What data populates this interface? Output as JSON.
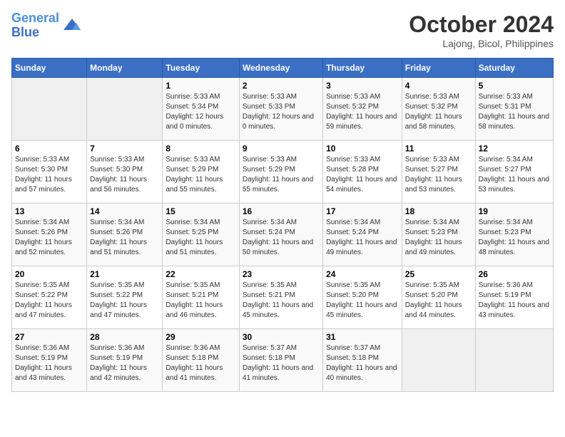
{
  "header": {
    "logo_line1": "General",
    "logo_line2": "Blue",
    "month": "October 2024",
    "location": "Lajong, Bicol, Philippines"
  },
  "weekdays": [
    "Sunday",
    "Monday",
    "Tuesday",
    "Wednesday",
    "Thursday",
    "Friday",
    "Saturday"
  ],
  "weeks": [
    [
      {
        "day": "",
        "empty": true
      },
      {
        "day": "",
        "empty": true
      },
      {
        "day": "1",
        "rise": "5:33 AM",
        "set": "5:34 PM",
        "daylight": "12 hours and 0 minutes."
      },
      {
        "day": "2",
        "rise": "5:33 AM",
        "set": "5:33 PM",
        "daylight": "12 hours and 0 minutes."
      },
      {
        "day": "3",
        "rise": "5:33 AM",
        "set": "5:32 PM",
        "daylight": "11 hours and 59 minutes."
      },
      {
        "day": "4",
        "rise": "5:33 AM",
        "set": "5:32 PM",
        "daylight": "11 hours and 58 minutes."
      },
      {
        "day": "5",
        "rise": "5:33 AM",
        "set": "5:31 PM",
        "daylight": "11 hours and 58 minutes."
      }
    ],
    [
      {
        "day": "6",
        "rise": "5:33 AM",
        "set": "5:30 PM",
        "daylight": "11 hours and 57 minutes."
      },
      {
        "day": "7",
        "rise": "5:33 AM",
        "set": "5:30 PM",
        "daylight": "11 hours and 56 minutes."
      },
      {
        "day": "8",
        "rise": "5:33 AM",
        "set": "5:29 PM",
        "daylight": "11 hours and 55 minutes."
      },
      {
        "day": "9",
        "rise": "5:33 AM",
        "set": "5:29 PM",
        "daylight": "11 hours and 55 minutes."
      },
      {
        "day": "10",
        "rise": "5:33 AM",
        "set": "5:28 PM",
        "daylight": "11 hours and 54 minutes."
      },
      {
        "day": "11",
        "rise": "5:33 AM",
        "set": "5:27 PM",
        "daylight": "11 hours and 53 minutes."
      },
      {
        "day": "12",
        "rise": "5:34 AM",
        "set": "5:27 PM",
        "daylight": "11 hours and 53 minutes."
      }
    ],
    [
      {
        "day": "13",
        "rise": "5:34 AM",
        "set": "5:26 PM",
        "daylight": "11 hours and 52 minutes."
      },
      {
        "day": "14",
        "rise": "5:34 AM",
        "set": "5:26 PM",
        "daylight": "11 hours and 51 minutes."
      },
      {
        "day": "15",
        "rise": "5:34 AM",
        "set": "5:25 PM",
        "daylight": "11 hours and 51 minutes."
      },
      {
        "day": "16",
        "rise": "5:34 AM",
        "set": "5:24 PM",
        "daylight": "11 hours and 50 minutes."
      },
      {
        "day": "17",
        "rise": "5:34 AM",
        "set": "5:24 PM",
        "daylight": "11 hours and 49 minutes."
      },
      {
        "day": "18",
        "rise": "5:34 AM",
        "set": "5:23 PM",
        "daylight": "11 hours and 49 minutes."
      },
      {
        "day": "19",
        "rise": "5:34 AM",
        "set": "5:23 PM",
        "daylight": "11 hours and 48 minutes."
      }
    ],
    [
      {
        "day": "20",
        "rise": "5:35 AM",
        "set": "5:22 PM",
        "daylight": "11 hours and 47 minutes."
      },
      {
        "day": "21",
        "rise": "5:35 AM",
        "set": "5:22 PM",
        "daylight": "11 hours and 47 minutes."
      },
      {
        "day": "22",
        "rise": "5:35 AM",
        "set": "5:21 PM",
        "daylight": "11 hours and 46 minutes."
      },
      {
        "day": "23",
        "rise": "5:35 AM",
        "set": "5:21 PM",
        "daylight": "11 hours and 45 minutes."
      },
      {
        "day": "24",
        "rise": "5:35 AM",
        "set": "5:20 PM",
        "daylight": "11 hours and 45 minutes."
      },
      {
        "day": "25",
        "rise": "5:35 AM",
        "set": "5:20 PM",
        "daylight": "11 hours and 44 minutes."
      },
      {
        "day": "26",
        "rise": "5:36 AM",
        "set": "5:19 PM",
        "daylight": "11 hours and 43 minutes."
      }
    ],
    [
      {
        "day": "27",
        "rise": "5:36 AM",
        "set": "5:19 PM",
        "daylight": "11 hours and 43 minutes."
      },
      {
        "day": "28",
        "rise": "5:36 AM",
        "set": "5:19 PM",
        "daylight": "11 hours and 42 minutes."
      },
      {
        "day": "29",
        "rise": "5:36 AM",
        "set": "5:18 PM",
        "daylight": "11 hours and 41 minutes."
      },
      {
        "day": "30",
        "rise": "5:37 AM",
        "set": "5:18 PM",
        "daylight": "11 hours and 41 minutes."
      },
      {
        "day": "31",
        "rise": "5:37 AM",
        "set": "5:18 PM",
        "daylight": "11 hours and 40 minutes."
      },
      {
        "day": "",
        "empty": true
      },
      {
        "day": "",
        "empty": true
      }
    ]
  ],
  "labels": {
    "sunrise": "Sunrise:",
    "sunset": "Sunset:",
    "daylight": "Daylight:"
  }
}
